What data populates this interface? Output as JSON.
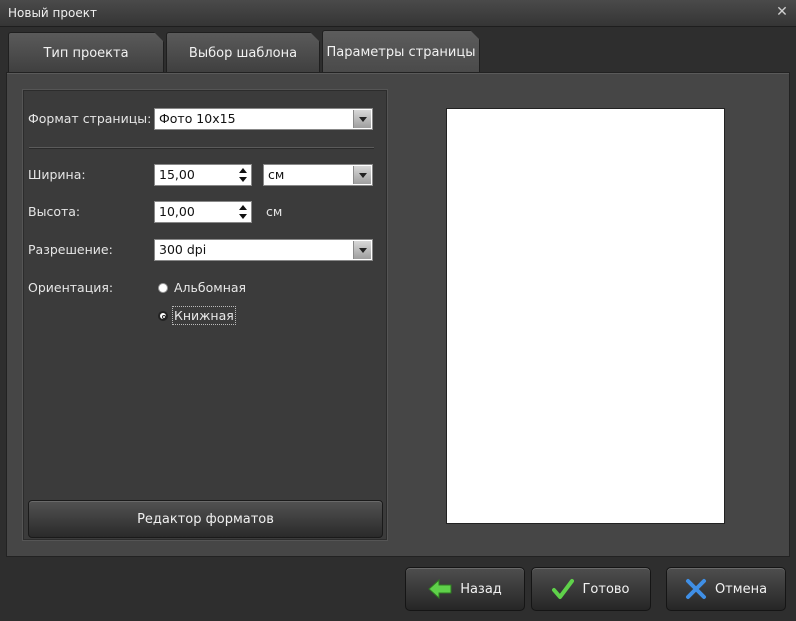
{
  "window": {
    "title": "Новый проект",
    "close_glyph": "✕"
  },
  "tabs": [
    {
      "label": "Тип проекта"
    },
    {
      "label": "Выбор шаблона"
    },
    {
      "label": "Параметры страницы",
      "active": true
    }
  ],
  "form": {
    "format_label": "Формат страницы:",
    "format_value": "Фото 10x15",
    "width_label": "Ширина:",
    "width_value": "15,00",
    "unit_value": "см",
    "height_label": "Высота:",
    "height_value": "10,00",
    "height_unit": "см",
    "resolution_label": "Разрешение:",
    "resolution_value": "300 dpi",
    "orientation_label": "Ориентация:",
    "orientation_options": [
      {
        "label": "Альбомная",
        "selected": false
      },
      {
        "label": "Книжная",
        "selected": true
      }
    ],
    "format_editor_button": "Редактор форматов"
  },
  "footer": {
    "back_label": "Назад",
    "done_label": "Готово",
    "cancel_label": "Отмена"
  },
  "colors": {
    "background": "#2e2e2e",
    "panel": "#464646",
    "back_icon": "#5fd14a",
    "done_icon": "#5fd14a",
    "cancel_icon": "#3f8fe6"
  }
}
